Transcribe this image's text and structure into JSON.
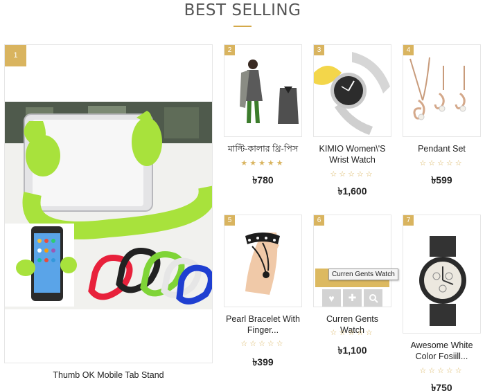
{
  "section": {
    "title": "BEST SELLING"
  },
  "colors": {
    "accent": "#d9b45f",
    "card_border": "#e6e6e6",
    "text": "#222222"
  },
  "products": [
    {
      "rank": "1",
      "name": "Thumb OK Mobile Tab Stand",
      "stars": "",
      "price": "",
      "rating": null
    },
    {
      "rank": "2",
      "name": "মাল্টি-কালার থ্রি-পিস",
      "stars": "★★★★★",
      "price": "৳780",
      "rating": 5
    },
    {
      "rank": "3",
      "name": "KIMIO Women\\'S Wrist Watch",
      "stars": "☆☆☆☆☆",
      "price": "৳1,600",
      "rating": 0
    },
    {
      "rank": "4",
      "name": "Pendant Set",
      "stars": "☆☆☆☆☆",
      "price": "৳599",
      "rating": 0
    },
    {
      "rank": "5",
      "name": "Pearl Bracelet With Finger...",
      "stars": "☆☆☆☆☆",
      "price": "৳399",
      "rating": 0
    },
    {
      "rank": "6",
      "name": "Curren Gents Watch",
      "stars": "☆☆☆☆☆",
      "price": "৳1,100",
      "rating": 0
    },
    {
      "rank": "7",
      "name": "Awesome White Color Fosiill...",
      "stars": "☆☆☆☆☆",
      "price": "৳750",
      "rating": 0
    }
  ],
  "hover": {
    "tooltip": "Curren Gents Watch",
    "icons": [
      "heart-icon",
      "plus-icon",
      "search-icon"
    ]
  }
}
